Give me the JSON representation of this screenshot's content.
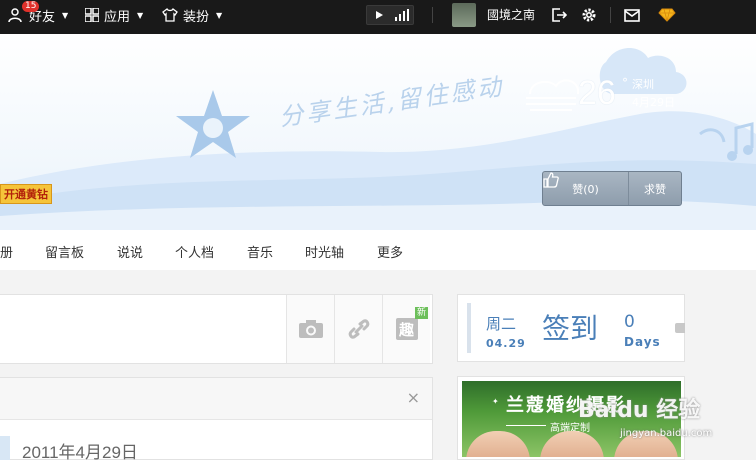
{
  "topbar": {
    "friends": {
      "label": "好友",
      "badge": "15"
    },
    "apps": {
      "label": "应用"
    },
    "dress": {
      "label": "装扮"
    },
    "user": {
      "name": "國境之南"
    }
  },
  "banner": {
    "slogan": "分享生活,留住感动",
    "weather": {
      "temp": "26",
      "deg": "°",
      "city": "深圳",
      "date": "4月29日"
    },
    "vip_tag": "开通黄钻",
    "like": {
      "label": "赞(0)"
    },
    "seek_like": {
      "label": "求赞"
    }
  },
  "nav": {
    "items": [
      "册",
      "留言板",
      "说说",
      "个人档",
      "音乐",
      "时光轴",
      "更多"
    ]
  },
  "post": {
    "tools": [
      {
        "icon": "camera-icon"
      },
      {
        "icon": "attachment-icon"
      },
      {
        "icon": "fun-icon",
        "glyph": "趣",
        "tag": "新"
      }
    ]
  },
  "feed": {
    "date": "2011年4月29日",
    "close": "×"
  },
  "checkin": {
    "weekday": "周二",
    "date": "04.29",
    "label": "签到",
    "count": "0",
    "unit": "Days"
  },
  "ad": {
    "title": "兰蔻婚纱摄影",
    "subtitle": "高端定制"
  },
  "watermark": {
    "text": "Baidu 经验",
    "url": "jingyan.baidu.com"
  },
  "colors": {
    "topbar": "#191919",
    "accent_blue": "#4a7fb8",
    "vip_gold": "#f5c43a",
    "badge_red": "#e0312b"
  }
}
